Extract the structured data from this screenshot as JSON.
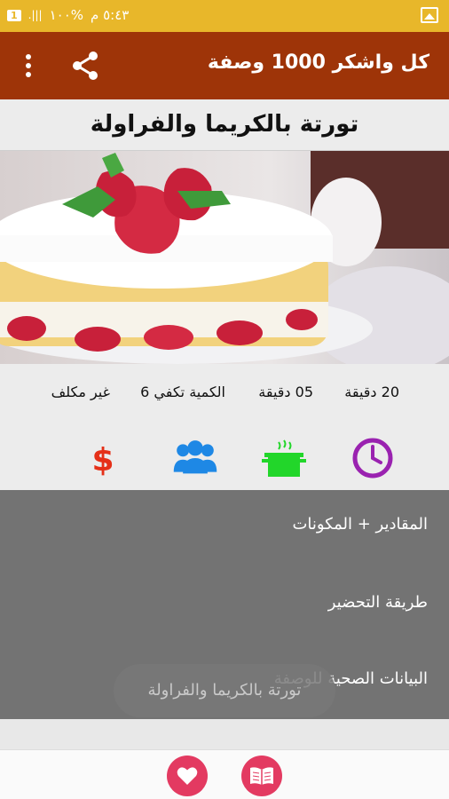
{
  "status_bar": {
    "time": "٥:٤٣ م",
    "battery": "%١٠٠",
    "signal": "|||.",
    "notification_badge": "1"
  },
  "app_bar": {
    "title": "كل واشكر 1000 وصفة",
    "icons": [
      "share-icon",
      "overflow-menu-icon"
    ],
    "color": "#9e3408"
  },
  "recipe": {
    "title": "تورتة بالكريما والفراولة",
    "image_alt": "strawberry cream cake",
    "stats": {
      "prep_time": "20 دقيقة",
      "cook_time": "05 دقيقة",
      "servings": "الكمية تكفي 6",
      "cost": "غير مكلف"
    },
    "stat_icons": [
      "clock-icon",
      "pot-icon",
      "people-icon",
      "dollar-icon"
    ]
  },
  "menu": {
    "items": [
      {
        "label": "المقادير + المكونات"
      },
      {
        "label": "طريقة التحضير"
      },
      {
        "label": "البيانات الصحية للوصفة"
      }
    ]
  },
  "toast": {
    "text": "تورتة بالكريما والفراولة"
  },
  "bottom_bar": {
    "icons": [
      "heart-icon",
      "book-icon"
    ],
    "accent": "#e33a61"
  }
}
